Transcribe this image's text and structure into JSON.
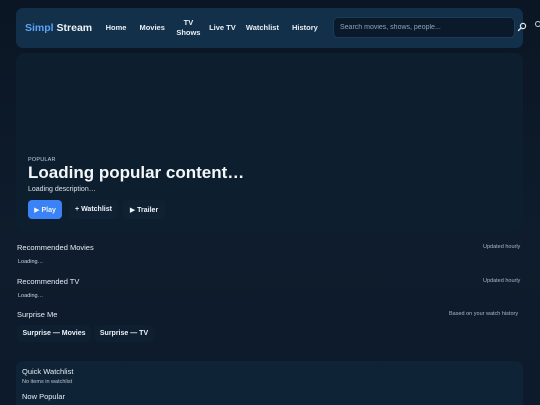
{
  "header": {
    "brand_part1": "Simpl",
    "brand_part2": "Stream",
    "nav": [
      "Home",
      "Movies",
      "TV Shows",
      "Live TV",
      "Watchlist",
      "History"
    ],
    "search_placeholder": "Search movies, shows, people..."
  },
  "hero": {
    "tag": "POPULAR",
    "title": "Loading popular content…",
    "description": "Loading description…",
    "buttons": {
      "play": "▶ Play",
      "watchlist": "+ Watchlist",
      "trailer": "▶ Trailer"
    }
  },
  "sections": {
    "recommended_movies": {
      "title": "Recommended Movies",
      "note": "Updated hourly",
      "status": "Loading…"
    },
    "recommended_tv": {
      "title": "Recommended TV",
      "note": "Updated hourly",
      "status": "Loading…"
    },
    "surprise": {
      "title": "Surprise Me",
      "note": "Based on your watch history",
      "buttons": [
        "Surprise — Movies",
        "Surprise — TV"
      ]
    }
  },
  "quick_watchlist": {
    "title": "Quick Watchlist",
    "empty": "No items in watchlist"
  },
  "now_popular": {
    "title": "Now Popular"
  },
  "colors": {
    "accent": "#3b82f6",
    "brand": "#5aa2f5",
    "header_bg": "#12304a"
  },
  "icons": {
    "search": "magnifier-icon"
  }
}
